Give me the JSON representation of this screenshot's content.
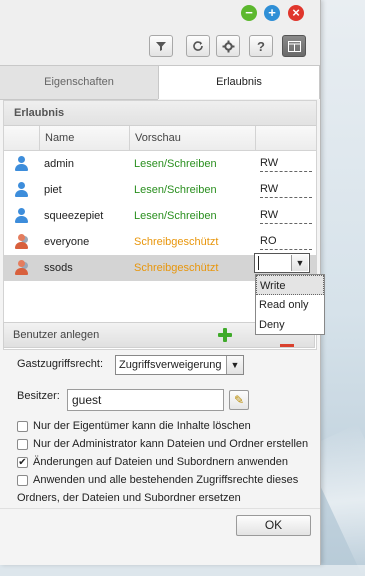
{
  "window": {
    "controls": [
      "minimize",
      "maximize",
      "close"
    ],
    "toolbar_icons": [
      "filter-icon",
      "refresh-icon",
      "gear-icon",
      "help-icon",
      "panel-icon"
    ]
  },
  "tabs": [
    {
      "label": "Eigenschaften",
      "active": false
    },
    {
      "label": "Erlaubnis",
      "active": true
    }
  ],
  "permissions": {
    "title": "Erlaubnis",
    "columns": [
      "Name",
      "Vorschau"
    ],
    "rows": [
      {
        "name": "admin",
        "preview": "Lesen/Schreiben",
        "perm": "RW",
        "type": "user",
        "color": "#2a8f1f"
      },
      {
        "name": "piet",
        "preview": "Lesen/Schreiben",
        "perm": "RW",
        "type": "user",
        "color": "#2a8f1f"
      },
      {
        "name": "squeezepiet",
        "preview": "Lesen/Schreiben",
        "perm": "RW",
        "type": "user",
        "color": "#2a8f1f"
      },
      {
        "name": "everyone",
        "preview": "Schreibgeschützt",
        "perm": "RO",
        "type": "group",
        "color": "#e8960c"
      },
      {
        "name": "ssods",
        "preview": "Schreibgeschützt",
        "perm": "",
        "type": "group",
        "color": "#e8960c",
        "selected": true
      }
    ],
    "dropdown_options": [
      "Write",
      "Read only",
      "Deny"
    ],
    "dropdown_highlighted": "Write"
  },
  "create_user": {
    "label": "Benutzer anlegen"
  },
  "guest_access": {
    "label": "Gastzugriffsrecht:",
    "value": "Zugriffsverweigerung"
  },
  "owner": {
    "label": "Besitzer:",
    "value": "guest"
  },
  "options": [
    {
      "label": "Nur der Eigentümer kann die Inhalte löschen",
      "checked": false
    },
    {
      "label": "Nur der Administrator kann Dateien und Ordner erstellen",
      "checked": false
    },
    {
      "label": "Änderungen auf Dateien und Subordnern anwenden",
      "checked": true
    },
    {
      "label": "Anwenden und alle bestehenden Zugriffsrechte dieses",
      "label2": "Ordners, der Dateien und Subordner ersetzen",
      "checked": false
    }
  ],
  "ok_label": "OK"
}
